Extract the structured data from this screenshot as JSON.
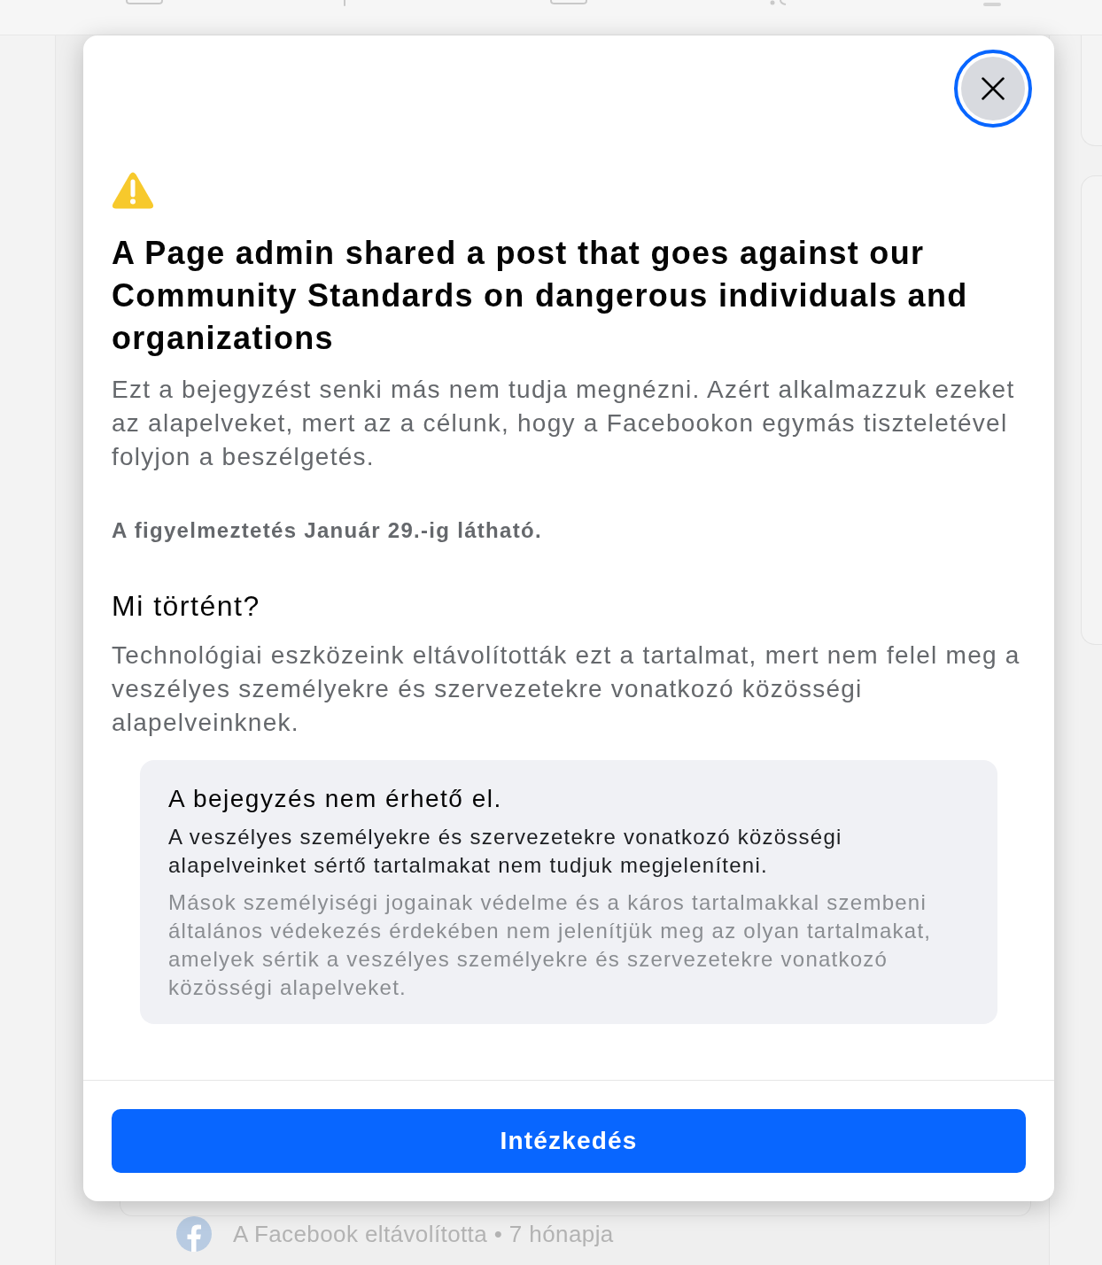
{
  "dialog": {
    "close_button": {
      "focused": true
    },
    "title": "A Page admin shared a post that goes against our Community Standards on dangerous individuals and organizations",
    "description": "Ezt a bejegyzést senki más nem tudja megnézni. Azért alkalmazzuk ezeket az alapelveket, mert az a célunk, hogy a Facebookon egymás tiszteletével folyjon a beszélgetés.",
    "expiry_note": "A figyelmeztetés Január 29.-ig látható.",
    "section": {
      "heading": "Mi történt?",
      "text": "Technológiai eszközeink eltávolították ezt a tartalmat, mert nem felel meg a veszélyes személyekre és szervezetekre vonatkozó közösségi alapelveinknek.",
      "notice": {
        "title": "A bejegyzés nem érhető el.",
        "text": "A veszélyes személyekre és szervezetekre vonatkozó közösségi alapelveinket sértő tartalmakat nem tudjuk megjeleníteni.",
        "detail": "Mások személyiségi jogainak védelme és a káros tartalmakkal szembeni általános védekezés érdekében nem jelenítjük meg az olyan tartalmakat, amelyek sértik a veszélyes személyekre és szervezetekre vonatkozó közösségi alapelveket."
      }
    },
    "action_button": "Intézkedés"
  },
  "background_post": {
    "status": "A Facebook eltávolította • 7 hónapja"
  }
}
